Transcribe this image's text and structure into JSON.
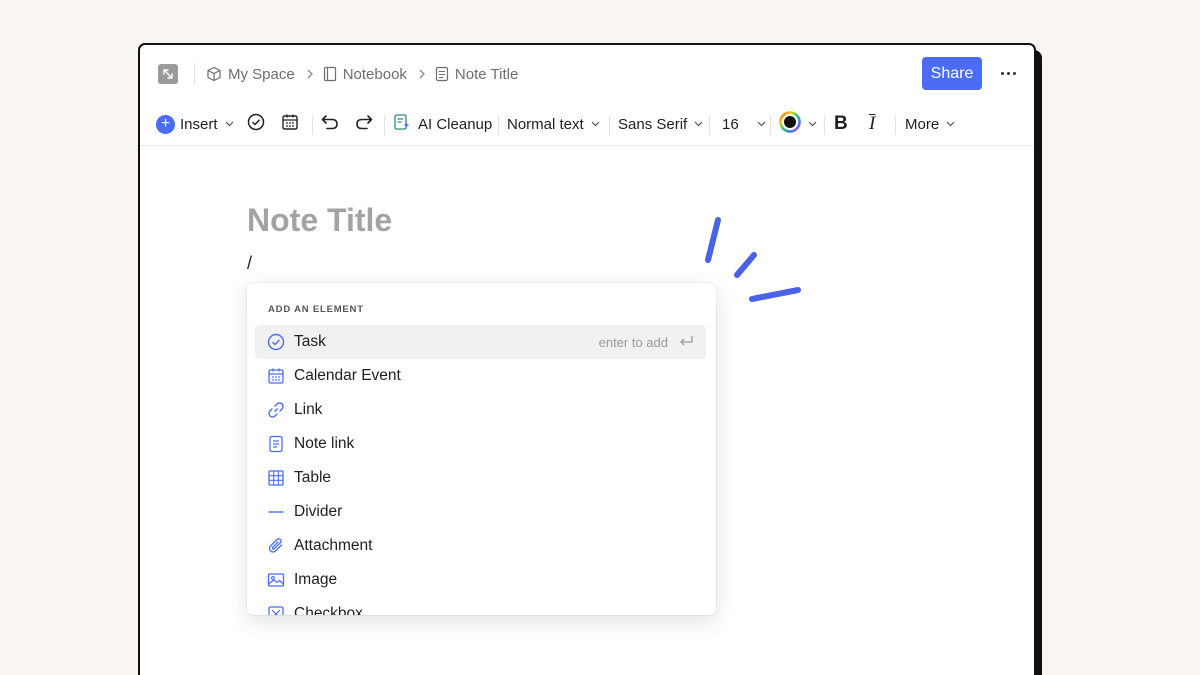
{
  "breadcrumb": {
    "items": [
      {
        "label": "My Space",
        "icon": "cube-icon"
      },
      {
        "label": "Notebook",
        "icon": "notebook-icon"
      },
      {
        "label": "Note Title",
        "icon": "document-icon"
      }
    ],
    "separator": ">"
  },
  "header": {
    "share_label": "Share"
  },
  "toolbar": {
    "insert_label": "Insert",
    "ai_cleanup_label": "AI Cleanup",
    "text_style": "Normal text",
    "font_family": "Sans Serif",
    "font_size": "16",
    "bold_label": "B",
    "italic_label": "I",
    "more_label": "More",
    "text_color": "#111111"
  },
  "editor": {
    "title_placeholder": "Note Title",
    "current_line": "/"
  },
  "insert_menu": {
    "header": "ADD AN ELEMENT",
    "enter_hint": "enter to add",
    "items": [
      {
        "label": "Task",
        "icon": "check-circle-icon"
      },
      {
        "label": "Calendar Event",
        "icon": "calendar-icon"
      },
      {
        "label": "Link",
        "icon": "link-icon"
      },
      {
        "label": "Note link",
        "icon": "note-link-icon"
      },
      {
        "label": "Table",
        "icon": "table-icon"
      },
      {
        "label": "Divider",
        "icon": "divider-icon"
      },
      {
        "label": "Attachment",
        "icon": "paperclip-icon"
      },
      {
        "label": "Image",
        "icon": "image-icon"
      },
      {
        "label": "Checkbox",
        "icon": "checkbox-icon"
      }
    ]
  },
  "colors": {
    "accent": "#4a6cf7",
    "background": "#f8f5f2"
  }
}
